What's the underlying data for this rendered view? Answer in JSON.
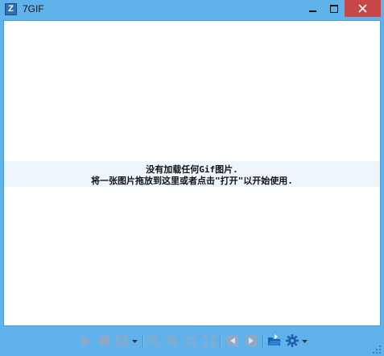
{
  "window": {
    "title": "7GIF",
    "icon_letter": "Z"
  },
  "content": {
    "message_line1": "没有加载任何Gif图片.",
    "message_line2": "将一张图片拖放到这里或者点击\"打开\"以开始使用."
  },
  "toolbar": {
    "buttons": [
      "play-icon",
      "stop-icon",
      "frames-icon",
      "zoom-out-icon",
      "zoom-in-icon",
      "fit-icon",
      "actual-size-icon",
      "previous-icon",
      "next-icon",
      "open-icon",
      "settings-icon"
    ]
  },
  "colors": {
    "frame": "#5fb3ea",
    "close_button": "#c74747",
    "message_band": "#eef5fc"
  }
}
